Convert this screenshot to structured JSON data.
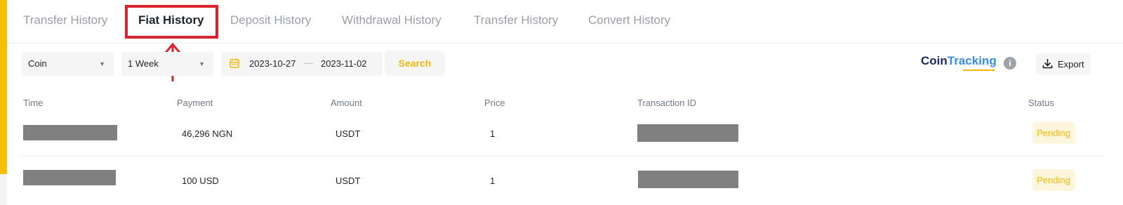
{
  "tabs": [
    {
      "label": "Transfer History"
    },
    {
      "label": "Fiat History"
    },
    {
      "label": "Deposit History"
    },
    {
      "label": "Withdrawal History"
    },
    {
      "label": "Transfer History"
    },
    {
      "label": "Convert History"
    }
  ],
  "active_tab": "Fiat History",
  "filters": {
    "coin_label": "Coin",
    "period_label": "1 Week",
    "date_start": "2023-10-27",
    "date_separator": "—",
    "date_end": "2023-11-02",
    "search_label": "Search"
  },
  "toolbar": {
    "cointracking_part1": "Coin",
    "cointracking_part2": "Tracking",
    "info_glyph": "i",
    "export_label": "Export"
  },
  "table": {
    "headers": [
      "Time",
      "Payment",
      "Amount",
      "Price",
      "Transaction ID",
      "Status"
    ],
    "rows": [
      {
        "payment": "46,296 NGN",
        "amount": "USDT",
        "price": "1",
        "status": "Pending"
      },
      {
        "payment": "100 USD",
        "amount": "USDT",
        "price": "1",
        "status": "Pending"
      }
    ]
  },
  "colors": {
    "accent": "#f0b90b",
    "annotation": "#d9232e",
    "redaction": "#808080"
  }
}
